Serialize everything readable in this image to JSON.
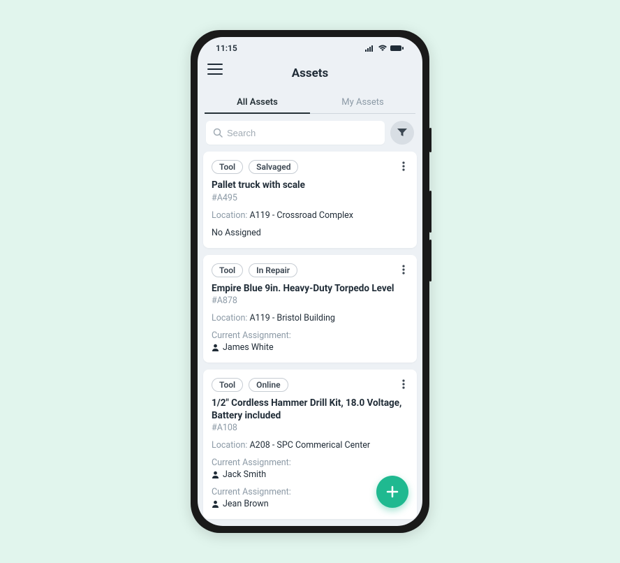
{
  "status": {
    "time": "11:15"
  },
  "header": {
    "title": "Assets"
  },
  "tabs": [
    {
      "label": "All Assets",
      "active": true
    },
    {
      "label": "My Assets",
      "active": false
    }
  ],
  "search": {
    "placeholder": "Search"
  },
  "assets": [
    {
      "badges": [
        "Tool",
        "Salvaged"
      ],
      "title": "Pallet truck with scale",
      "code": "#A495",
      "location_label": "Location:",
      "location_value": "A119 - Crossroad Complex",
      "no_assigned_label": "No Assigned",
      "assignments": []
    },
    {
      "badges": [
        "Tool",
        "In Repair"
      ],
      "title": "Empire Blue 9in. Heavy-Duty Torpedo Level",
      "code": "#A878",
      "location_label": "Location:",
      "location_value": "A119 - Bristol Building",
      "assignments": [
        {
          "label": "Current Assignment:",
          "name": "James White"
        }
      ]
    },
    {
      "badges": [
        "Tool",
        "Online"
      ],
      "title": "1/2\" Cordless Hammer Drill Kit, 18.0 Voltage, Battery included",
      "code": "#A108",
      "location_label": "Location:",
      "location_value": "A208 - SPC Commerical Center",
      "assignments": [
        {
          "label": "Current Assignment:",
          "name": "Jack Smith"
        },
        {
          "label": "Current Assignment:",
          "name": "Jean Brown"
        }
      ]
    }
  ]
}
